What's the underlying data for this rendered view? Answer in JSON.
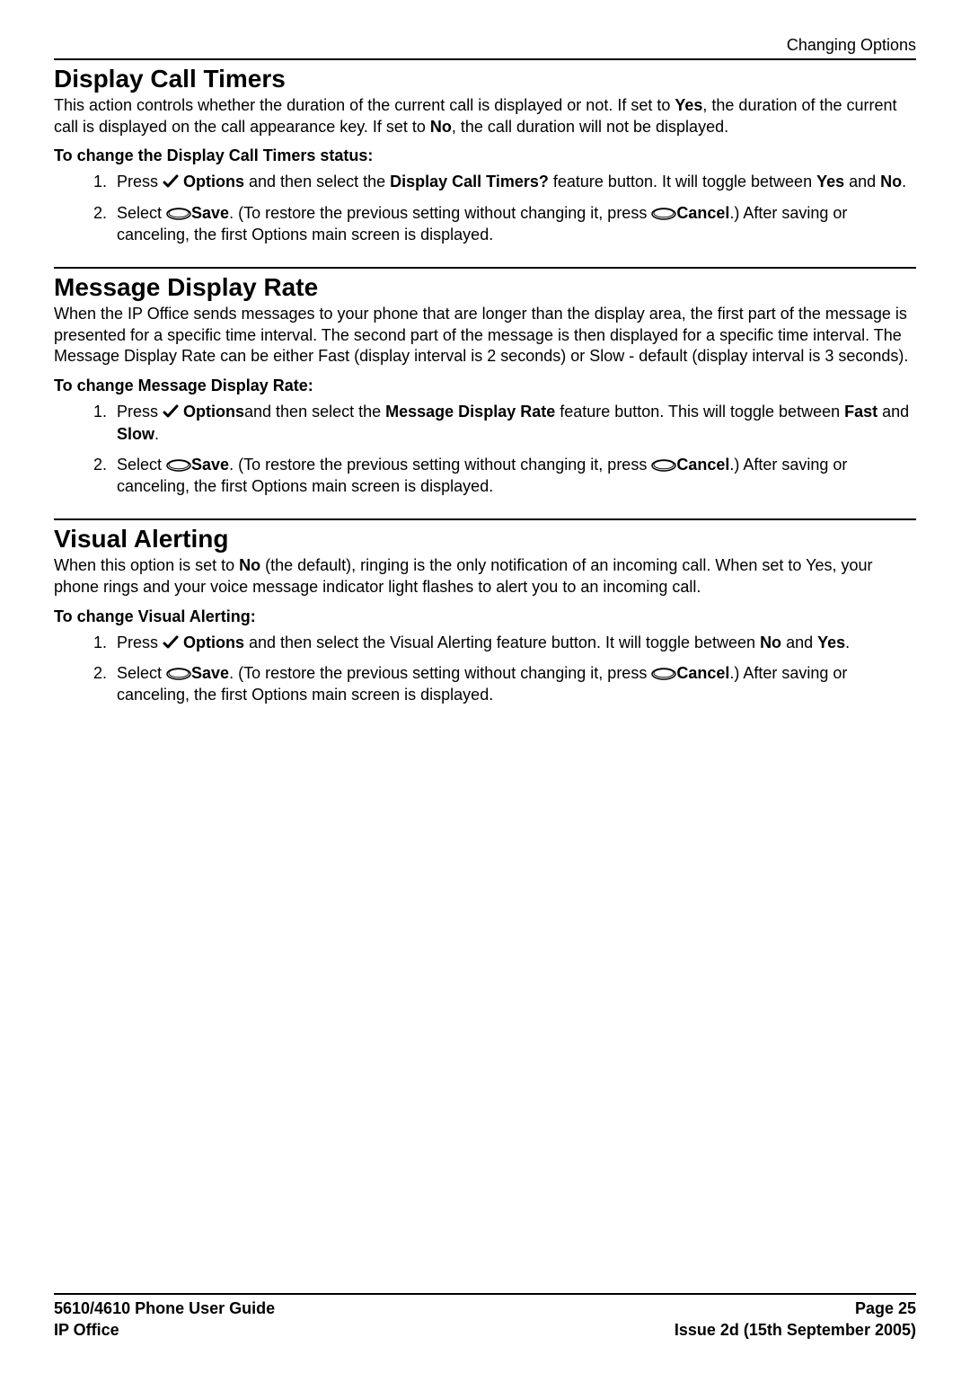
{
  "running_header": "Changing Options",
  "sections": [
    {
      "title": "Display Call Timers",
      "intro_parts": {
        "p1": "This action controls whether the duration of the current call is displayed or not. If set to ",
        "yes": "Yes",
        "p2": ", the duration of the current call is displayed on the call appearance key. If set to ",
        "no": "No",
        "p3": ", the call duration will not be displayed."
      },
      "subheading": "To change the Display Call Timers status:",
      "step1": {
        "t1": "Press ",
        "options": " Options",
        "t2": " and then select the ",
        "feature": "Display Call Timers?",
        "t3": " feature button. It will toggle between ",
        "yes": "Yes",
        "t4": " and ",
        "no": "No",
        "t5": "."
      },
      "step2": {
        "t1": "Select ",
        "save": "Save",
        "t2": ". (To restore the previous setting without changing it, press ",
        "cancel": "Cancel",
        "t3": ".) After saving or canceling, the first Options main screen is displayed."
      }
    },
    {
      "title": "Message Display Rate",
      "intro": "When the IP Office sends messages to your phone that are longer than the display area, the first part of the message is presented for a specific time interval. The second part of the message is then displayed for a specific time interval. The Message Display Rate can be either Fast (display interval is 2 seconds) or Slow - default (display interval is 3 seconds).",
      "subheading": "To change Message Display Rate:",
      "step1": {
        "t1": "Press ",
        "options": " Options",
        "t2": "and then select the ",
        "feature": "Message Display Rate",
        "t3": " feature button. This will toggle between ",
        "fast": "Fast",
        "t4": " and ",
        "slow": "Slow",
        "t5": "."
      },
      "step2": {
        "t1": "Select ",
        "save": "Save",
        "t2": ". (To restore the previous setting without changing it, press ",
        "cancel": "Cancel",
        "t3": ".) After saving or canceling, the first Options main screen is displayed."
      }
    },
    {
      "title": "Visual Alerting",
      "intro_parts": {
        "p1": "When this option is set to ",
        "no": "No",
        "p2": " (the default), ringing is the only notification of an incoming call. When set to Yes, your phone rings and your voice message indicator light flashes to alert you to an incoming call."
      },
      "subheading": "To change Visual Alerting:",
      "step1": {
        "t1": "Press ",
        "options": " Options",
        "t2": " and then select the Visual Alerting feature button. It will toggle between ",
        "no": "No",
        "t3": " and ",
        "yes": "Yes",
        "t4": "."
      },
      "step2": {
        "t1": "Select ",
        "save": "Save",
        "t2": ". (To restore the previous setting without changing it, press ",
        "cancel": "Cancel",
        "t3": ".) After saving or canceling, the first Options main screen is displayed."
      }
    }
  ],
  "footer": {
    "left1": "5610/4610 Phone User Guide",
    "left2": "IP Office",
    "right1": "Page 25",
    "right2": "Issue 2d (15th September 2005)"
  }
}
